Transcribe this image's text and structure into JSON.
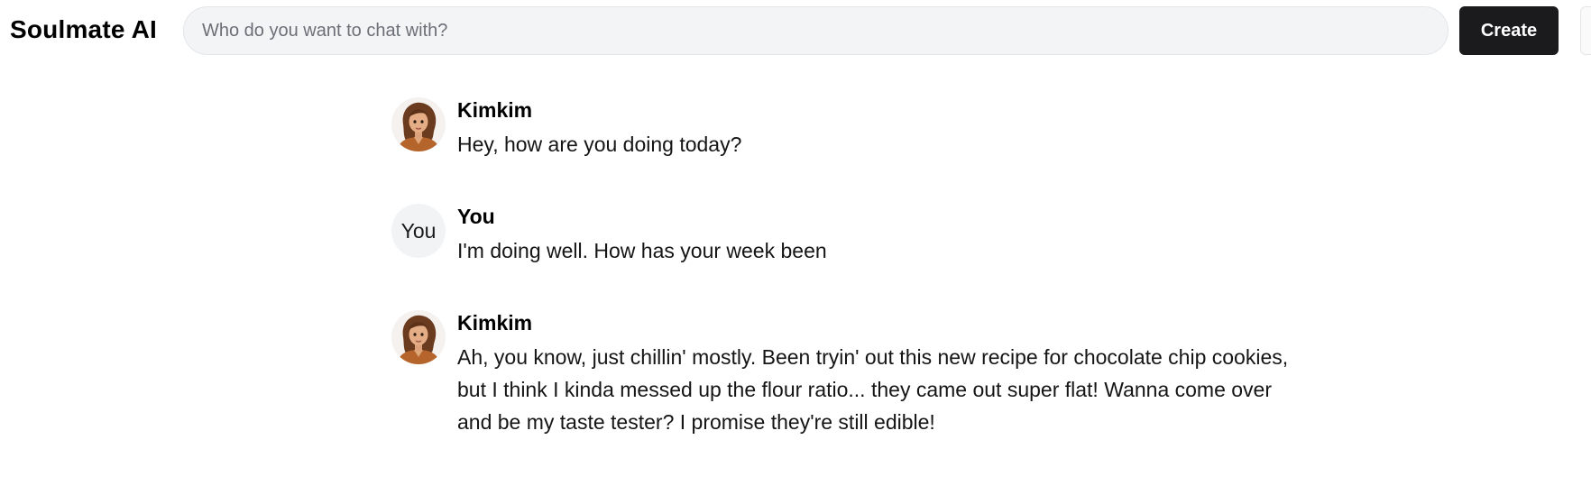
{
  "header": {
    "brand": "Soulmate AI",
    "search_placeholder": "Who do you want to chat with?",
    "create_label": "Create"
  },
  "messages": [
    {
      "author": "Kimkim",
      "avatar": "character-portrait",
      "text": "Hey, how are you doing today?"
    },
    {
      "author": "You",
      "avatar_label": "You",
      "text": "I'm doing well. How has your week been"
    },
    {
      "author": "Kimkim",
      "avatar": "character-portrait",
      "text": "Ah, you know, just chillin' mostly. Been tryin' out this new recipe for chocolate chip cookies, but I think I kinda messed up the flour ratio... they came out super flat! Wanna come over and be my taste tester? I promise they're still edible!"
    }
  ]
}
